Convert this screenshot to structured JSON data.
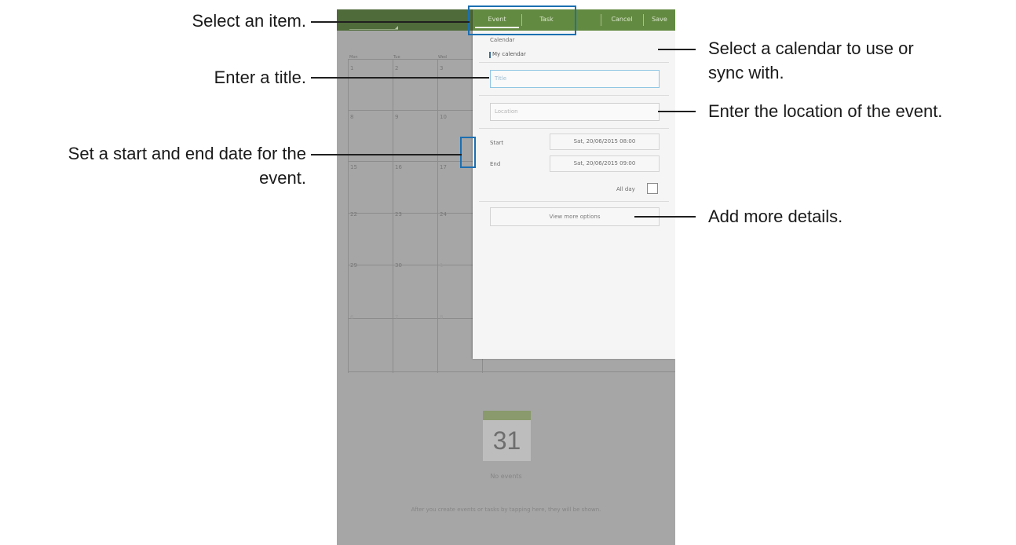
{
  "screen": {
    "action_bar": {
      "cancel_label": "Cancel",
      "save_label": "Save"
    },
    "weekdays": [
      "Mon",
      "Tue",
      "Wed"
    ],
    "calendar_rows": [
      [
        "1",
        "2",
        "3"
      ],
      [
        "8",
        "9",
        "10"
      ],
      [
        "15",
        "16",
        "17"
      ],
      [
        "22",
        "23",
        "24"
      ],
      [
        "29",
        "30",
        "1"
      ],
      [
        "6",
        "7",
        "8"
      ]
    ],
    "no_events": {
      "day_number": "31",
      "title": "No events",
      "hint": "After you create events or tasks by tapping here, they will be shown."
    }
  },
  "popup": {
    "tabs": [
      {
        "label": "Event",
        "selected": true
      },
      {
        "label": "Task",
        "selected": false
      }
    ],
    "calendar_label": "Calendar",
    "calendar_value": "My calendar",
    "title_placeholder": "Title",
    "location_placeholder": "Location",
    "start_label": "Start",
    "start_value": "Sat, 20/06/2015  08:00",
    "end_label": "End",
    "end_value": "Sat, 20/06/2015  09:00",
    "all_day_label": "All day",
    "all_day_checked": false,
    "more_options_label": "View more options"
  },
  "callouts": {
    "select_item": "Select an item.",
    "enter_title": "Enter a title.",
    "set_dates_line1": "Set a start and end date for the",
    "set_dates_line2": "event.",
    "select_calendar_line1": "Select a calendar to use or",
    "select_calendar_line2": "sync with.",
    "enter_location": "Enter the location of the event.",
    "add_details": "Add more details."
  },
  "colors": {
    "action_bar": "#4f6b3a",
    "popup_header": "#638a41",
    "highlight": "#1c6fb1"
  }
}
